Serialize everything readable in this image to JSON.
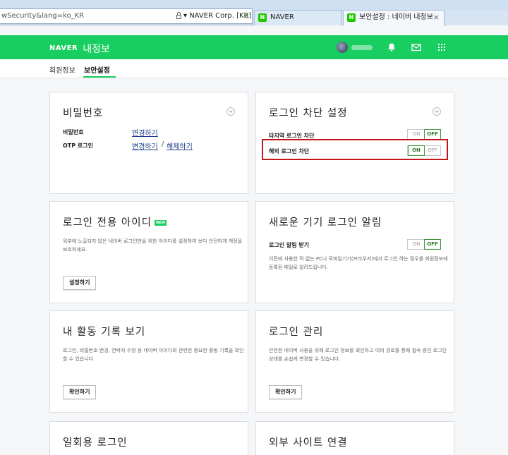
{
  "browser": {
    "address_url": "wSecurity&lang=ko_KR",
    "certificate": "NAVER Corp. [KR]",
    "tabs": [
      {
        "label": "NAVER"
      },
      {
        "label": "보안설정 : 네이버 내정보"
      }
    ],
    "favicon_letter": "N",
    "close": "×",
    "refresh": "c"
  },
  "header": {
    "logo": "NAVER",
    "service": "내정보"
  },
  "subnav": {
    "items": [
      {
        "label": "회원정보"
      },
      {
        "label": "보안설정"
      }
    ]
  },
  "cards": {
    "password": {
      "title": "비밀번호",
      "rows": [
        {
          "label": "비밀번호",
          "link": "변경하기"
        },
        {
          "label": "OTP 로그인",
          "link": "변경하기",
          "link2": "해제하기",
          "sep": "/"
        }
      ]
    },
    "login_block": {
      "title": "로그인 차단 설정",
      "rows": [
        {
          "label": "타지역 로그인 차단",
          "on": "ON",
          "off": "OFF",
          "state": "off"
        },
        {
          "label": "해외 로그인 차단",
          "on": "ON",
          "off": "OFF",
          "state": "on"
        }
      ]
    },
    "login_id": {
      "title": "로그인 전용 아이디",
      "badge": "NEW",
      "desc": "외부에 노출되지 않은 네이버 로그인만을 위한 아이디를 설정하여 보다 안전하게 계정을 보호하세요.",
      "button": "설정하기"
    },
    "new_device": {
      "title": "새로운 기기 로그인 알림",
      "row": {
        "label": "로그인 알림 받기",
        "on": "ON",
        "off": "OFF",
        "state": "off"
      },
      "desc": "이전에 사용한 적 없는 PC나 모바일기기(브라우저)에서 로그인 하는 경우를 회원정보에 등록된 메일로 알려드립니다."
    },
    "activity": {
      "title": "내 활동 기록 보기",
      "desc": "로그인, 비밀번호 변경, 연락처 수정 등 네이버 아이디와 관련된 중요한 활동 기록을 확인할 수 있습니다.",
      "button": "확인하기"
    },
    "login_manage": {
      "title": "로그인 관리",
      "desc": "안전한 네이버 사용을 위해 로그인 정보를 확인하고 여러 경로를 통해 접속 중인 로그인 상태를 손쉽게 변경할 수 있습니다.",
      "button": "확인하기"
    },
    "one_time": {
      "title": "일회용 로그인"
    },
    "external": {
      "title": "외부 사이트 연결"
    }
  }
}
